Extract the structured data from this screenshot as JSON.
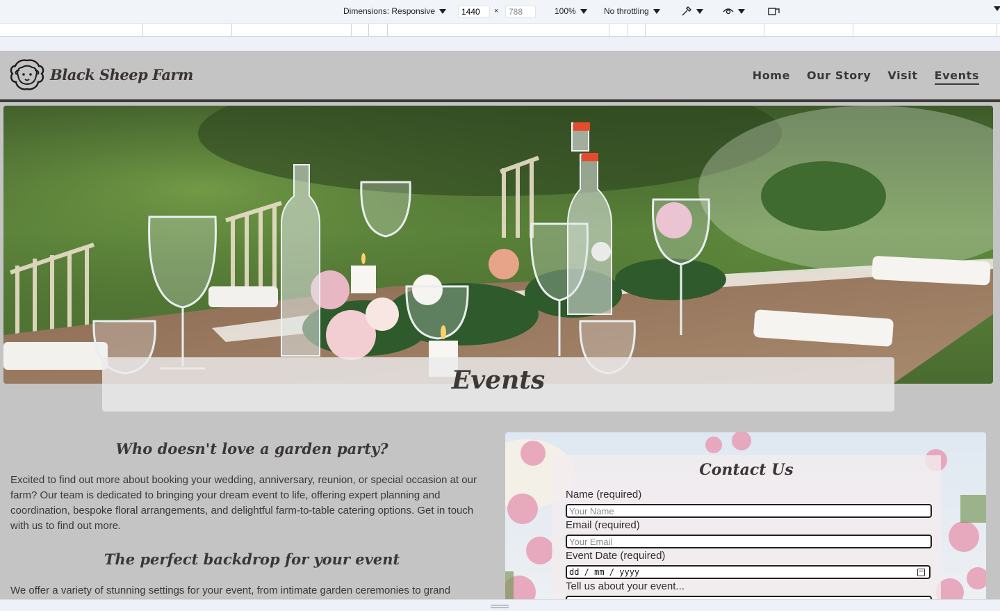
{
  "devtools": {
    "dimensions_label": "Dimensions: Responsive",
    "width_value": "1440",
    "times": "×",
    "height_value": "788",
    "zoom": "100%",
    "throttling": "No throttling"
  },
  "site": {
    "brand": "Black Sheep Farm",
    "nav": [
      {
        "label": "Home"
      },
      {
        "label": "Our Story"
      },
      {
        "label": "Visit"
      },
      {
        "label": "Events"
      }
    ],
    "active_nav": "Events"
  },
  "hero": {
    "title": "Events"
  },
  "content": {
    "heading1": "Who doesn't love a garden party?",
    "para1": "Excited to find out more about booking your wedding, anniversary, reunion, or special occasion at our farm? Our team is dedicated to bringing your dream event to life, offering expert planning and coordination, bespoke floral arrangements, and delightful farm-to-table catering options. Get in touch with us to find out more.",
    "heading2": "The perfect backdrop for your event",
    "para2": "We offer a variety of stunning settings for your event, from intimate garden ceremonies to grand"
  },
  "contact": {
    "title": "Contact Us",
    "name_label": "Name (required)",
    "name_placeholder": "Your Name",
    "email_label": "Email (required)",
    "email_placeholder": "Your Email",
    "date_label": "Event Date (required)",
    "date_placeholder": "dd / mm / yyyy",
    "message_label": "Tell us about your event..."
  },
  "colors": {
    "page_bg": "#c4c4c4",
    "header_rule": "#3d3a39",
    "text": "#3b3836"
  }
}
